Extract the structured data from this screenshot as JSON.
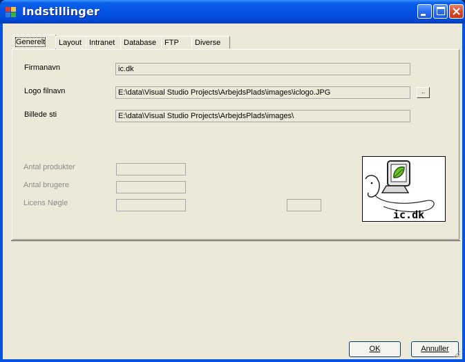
{
  "window": {
    "title": "Indstillinger"
  },
  "tabs": [
    {
      "label": "Generelt",
      "active": true
    },
    {
      "label": "Layout"
    },
    {
      "label": "Intranet"
    },
    {
      "label": "Database"
    },
    {
      "label": "FTP"
    },
    {
      "label": "Diverse"
    }
  ],
  "fields": {
    "firmanavn": {
      "label": "Firmanavn",
      "value": "ic.dk"
    },
    "logo_filnavn": {
      "label": "Logo filnavn",
      "value": "E:\\data\\Visual Studio Projects\\ArbejdsPlads\\images\\iclogo.JPG"
    },
    "billede_sti": {
      "label": "Billede sti",
      "value": "E:\\data\\Visual Studio Projects\\ArbejdsPlads\\images\\"
    },
    "antal_produkter": {
      "label": "Antal produkter",
      "value": ""
    },
    "antal_brugere": {
      "label": "Antal brugere",
      "value": ""
    },
    "licens_noegle": {
      "label": "Licens Nøgle",
      "value": ""
    }
  },
  "browse_label": "..",
  "logo_text": "ic.dk",
  "buttons": {
    "ok": "OK",
    "cancel": "Annuller"
  },
  "colors": {
    "titlebar": "#0453e3",
    "face": "#ece9d8",
    "disabled_text": "#8a8a8a"
  }
}
